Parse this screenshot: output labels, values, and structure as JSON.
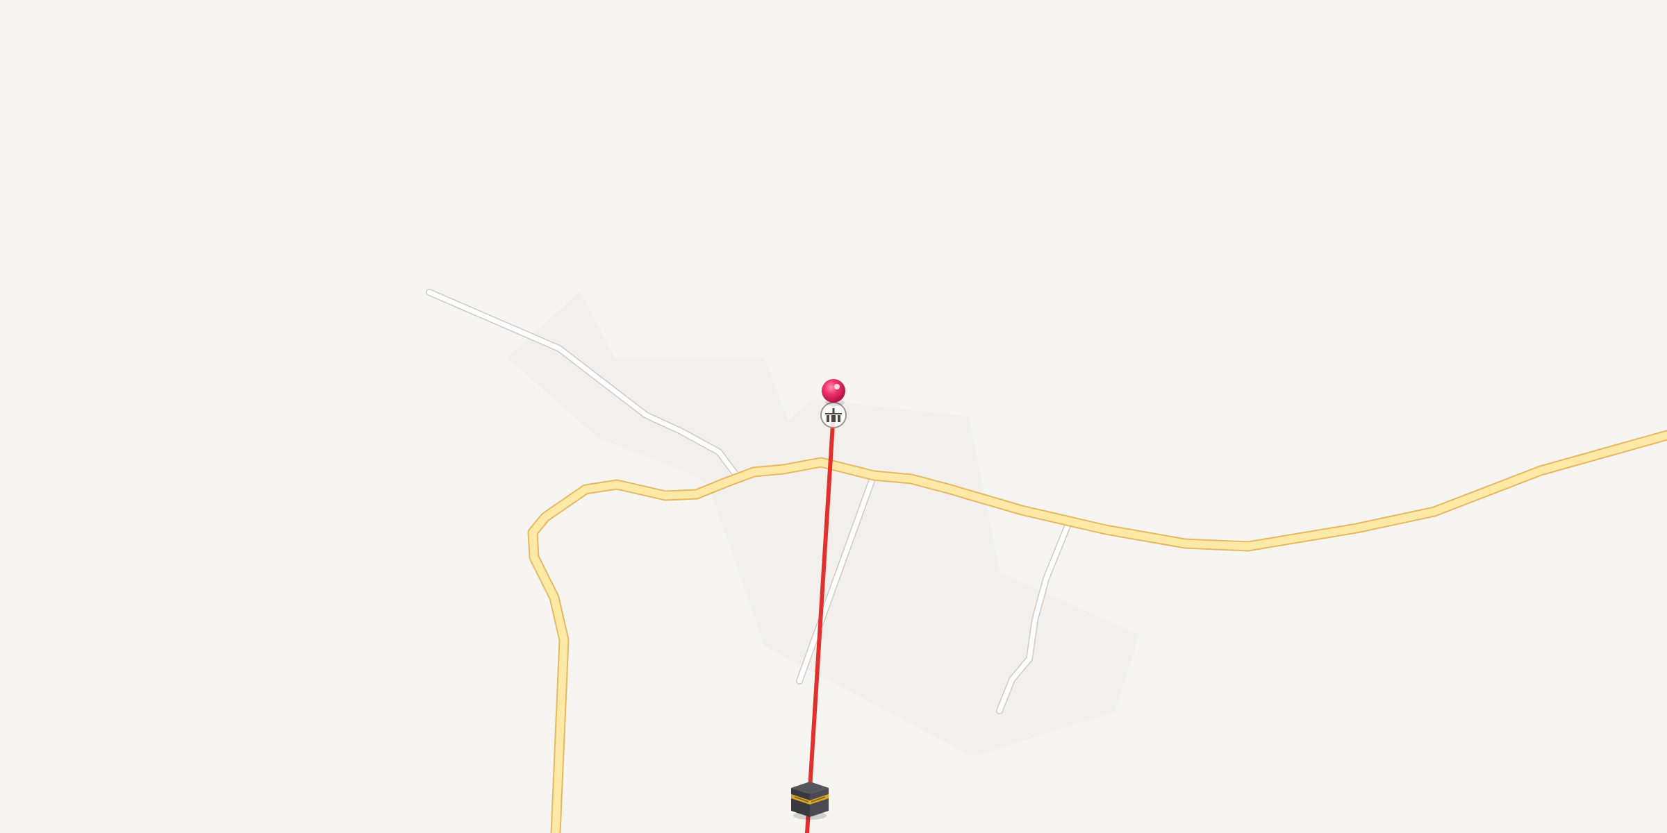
{
  "map": {
    "background_color": "#f7f5f1",
    "landuse_color": "#f2efec",
    "major_road": {
      "fill": "#fde8a6",
      "casing": "#e6b861"
    },
    "minor_road": {
      "fill": "#ffffff",
      "casing": "#cfcac3"
    },
    "qibla_line": {
      "color": "#e0302f"
    },
    "location_pin": {
      "icon": "location-pin-icon",
      "color": "#f0306a"
    },
    "mosque_marker": {
      "icon": "mosque-icon"
    },
    "kaaba_marker": {
      "icon": "kaaba-icon",
      "body_color": "#3a3a3e",
      "band_color": "#d8a72e"
    }
  }
}
